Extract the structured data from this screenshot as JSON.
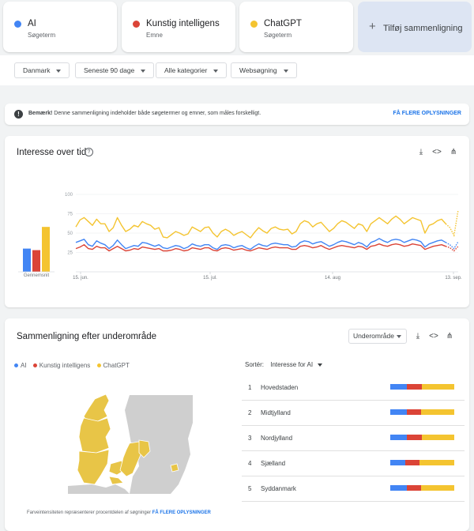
{
  "colors": {
    "ai": "#4285f4",
    "ki": "#db4437",
    "chatgpt": "#f4c430",
    "accent": "#1a73e8"
  },
  "terms": [
    {
      "name": "AI",
      "type": "Søgeterm",
      "color": "#4285f4"
    },
    {
      "name": "Kunstig intelligens",
      "type": "Emne",
      "color": "#db4437"
    },
    {
      "name": "ChatGPT",
      "type": "Søgeterm",
      "color": "#f4c430"
    }
  ],
  "add_comparison": "Tilføj sammenligning",
  "filters": {
    "country": "Danmark",
    "period": "Seneste 90 dage",
    "category": "Alle kategorier",
    "search_type": "Websøgning"
  },
  "notice": {
    "bold": "Bemærk!",
    "text": " Denne sammenligning indeholder både søgetermer og emner, som måles forskelligt.",
    "link": "FÅ FLERE OPLYSNINGER"
  },
  "interest": {
    "title": "Interesse over tid",
    "average_label": "Gennemsnit",
    "averages": [
      30,
      28,
      58
    ]
  },
  "chart_data": {
    "type": "line",
    "title": "Interesse over tid",
    "xlabel": "",
    "ylabel": "",
    "ylim": [
      0,
      100
    ],
    "ytick_labels": [
      "100",
      "75",
      "50",
      "25"
    ],
    "xtick_labels": [
      "15. jun.",
      "15. jul.",
      "14. aug",
      "13. sep."
    ],
    "grid": true,
    "series": [
      {
        "name": "AI",
        "color": "#4285f4",
        "values": [
          38,
          40,
          42,
          35,
          33,
          40,
          37,
          35,
          30,
          34,
          41,
          35,
          30,
          32,
          34,
          33,
          38,
          37,
          35,
          33,
          35,
          31,
          30,
          32,
          34,
          33,
          30,
          32,
          36,
          34,
          33,
          35,
          35,
          31,
          29,
          34,
          35,
          34,
          31,
          33,
          34,
          31,
          29,
          33,
          36,
          34,
          33,
          36,
          37,
          36,
          35,
          35,
          32,
          33,
          38,
          40,
          39,
          36,
          38,
          39,
          36,
          33,
          35,
          38,
          40,
          39,
          37,
          35,
          38,
          36,
          32,
          38,
          40,
          43,
          40,
          38,
          41,
          42,
          41,
          38,
          40,
          42,
          41,
          39,
          32,
          36,
          38,
          40,
          41,
          38,
          35,
          30,
          39
        ]
      },
      {
        "name": "Kunstig intelligens",
        "color": "#db4437",
        "values": [
          30,
          32,
          35,
          30,
          29,
          33,
          31,
          31,
          27,
          30,
          33,
          30,
          27,
          28,
          30,
          29,
          32,
          31,
          30,
          29,
          30,
          27,
          27,
          28,
          30,
          29,
          27,
          28,
          31,
          30,
          29,
          31,
          31,
          28,
          27,
          30,
          31,
          30,
          28,
          29,
          30,
          28,
          27,
          29,
          31,
          30,
          29,
          31,
          32,
          31,
          31,
          31,
          29,
          29,
          33,
          34,
          33,
          31,
          32,
          34,
          31,
          29,
          31,
          33,
          34,
          33,
          32,
          31,
          33,
          32,
          29,
          33,
          34,
          36,
          34,
          33,
          35,
          36,
          35,
          33,
          34,
          36,
          35,
          34,
          29,
          31,
          33,
          34,
          35,
          33,
          31,
          27,
          33
        ]
      },
      {
        "name": "ChatGPT",
        "color": "#f4c430",
        "values": [
          58,
          67,
          70,
          65,
          60,
          68,
          62,
          62,
          52,
          57,
          70,
          60,
          52,
          55,
          60,
          58,
          65,
          62,
          60,
          55,
          57,
          45,
          44,
          48,
          52,
          50,
          47,
          49,
          58,
          55,
          52,
          57,
          58,
          50,
          45,
          52,
          55,
          52,
          47,
          50,
          52,
          48,
          44,
          51,
          57,
          53,
          50,
          56,
          58,
          55,
          54,
          55,
          49,
          52,
          62,
          66,
          64,
          58,
          62,
          64,
          58,
          52,
          56,
          62,
          66,
          64,
          60,
          56,
          62,
          60,
          52,
          62,
          66,
          70,
          66,
          62,
          68,
          72,
          68,
          62,
          66,
          70,
          68,
          66,
          50,
          60,
          62,
          66,
          68,
          62,
          57,
          47,
          80
        ]
      }
    ]
  },
  "region": {
    "title": "Sammenligning efter underområde",
    "select_label": "Underområde",
    "sort_prefix": "Sortér:",
    "sort_value": "Interesse for AI",
    "rows": [
      {
        "rank": "1",
        "name": "Hovedstaden",
        "shares": [
          26,
          24,
          50
        ]
      },
      {
        "rank": "2",
        "name": "Midtjylland",
        "shares": [
          26,
          22,
          52
        ]
      },
      {
        "rank": "3",
        "name": "Nordjylland",
        "shares": [
          26,
          24,
          50
        ]
      },
      {
        "rank": "4",
        "name": "Sjælland",
        "shares": [
          24,
          22,
          54
        ]
      },
      {
        "rank": "5",
        "name": "Syddanmark",
        "shares": [
          26,
          22,
          52
        ]
      }
    ],
    "footnote": "Farveintensiteten repræsenterer procentdelen af søgninger",
    "footnote_link": "FÅ FLERE OPLYSNINGER"
  }
}
